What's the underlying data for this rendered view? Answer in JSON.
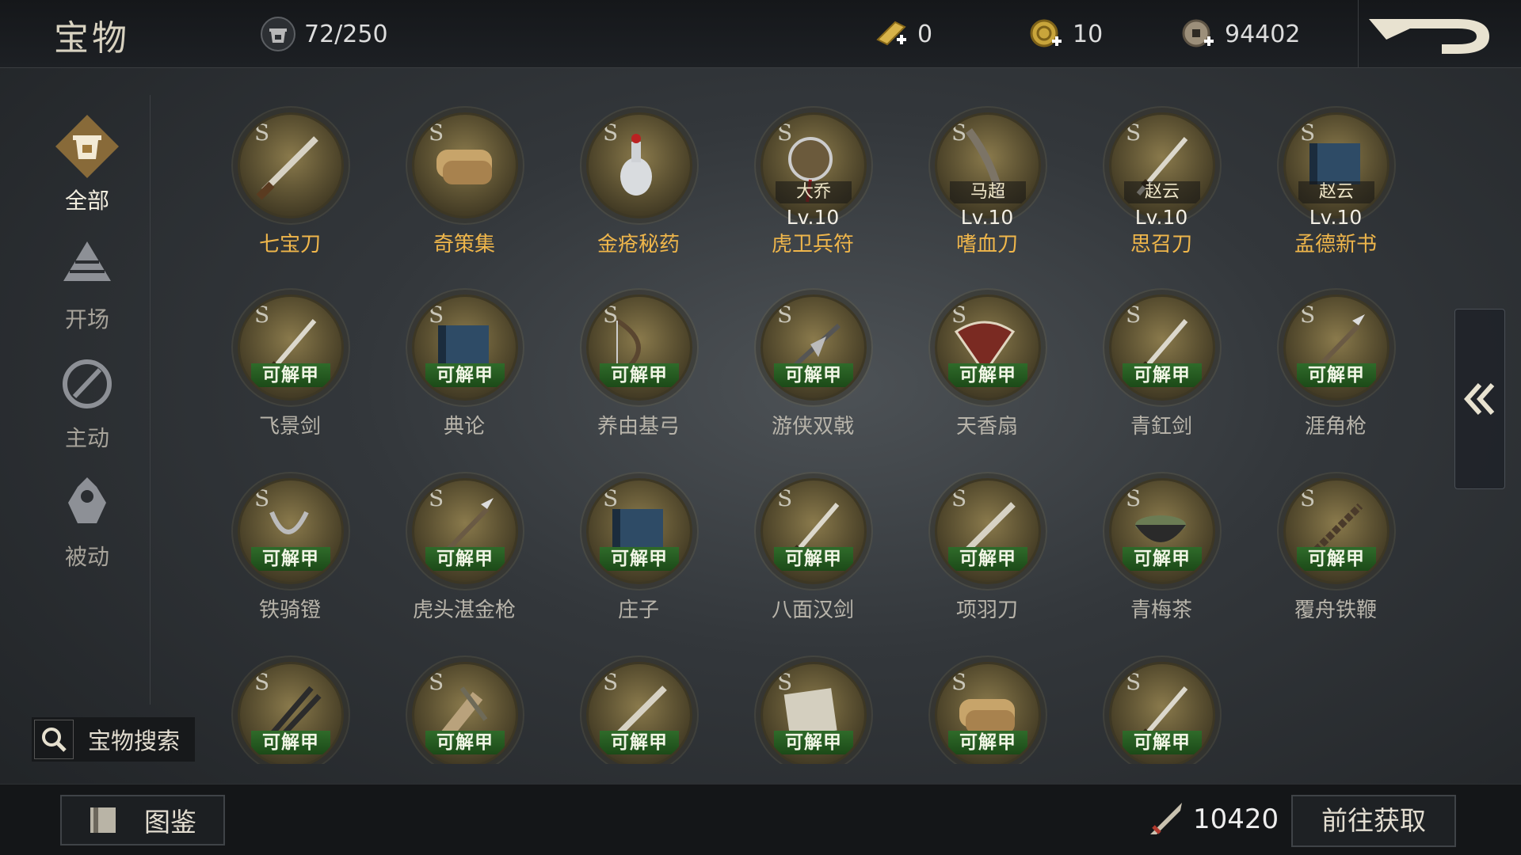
{
  "header": {
    "title": "宝物",
    "capacity": "72/250",
    "gold_ingot": "0",
    "coupon": "10",
    "silver": "94402"
  },
  "sidebar": {
    "items": [
      {
        "label": "全部",
        "icon": "all-treasure-icon",
        "active": true
      },
      {
        "label": "开场",
        "icon": "opening-icon",
        "active": false
      },
      {
        "label": "主动",
        "icon": "active-skill-icon",
        "active": false
      },
      {
        "label": "被动",
        "icon": "passive-skill-icon",
        "active": false
      }
    ],
    "search_label": "宝物搜索"
  },
  "grid": {
    "items": [
      {
        "name": "七宝刀",
        "grade": "S",
        "icon": "blade-icon",
        "name_color": "gold"
      },
      {
        "name": "奇策集",
        "grade": "S",
        "icon": "scrolls-icon",
        "name_color": "gold"
      },
      {
        "name": "金疮秘药",
        "grade": "S",
        "icon": "medicine-icon",
        "name_color": "gold"
      },
      {
        "name": "虎卫兵符",
        "grade": "S",
        "icon": "tiger-tally-icon",
        "name_color": "gold",
        "owner": "大乔",
        "level": "Lv.10"
      },
      {
        "name": "嗜血刀",
        "grade": "S",
        "icon": "blood-blade-icon",
        "name_color": "gold",
        "owner": "马超",
        "level": "Lv.10"
      },
      {
        "name": "思召刀",
        "grade": "S",
        "icon": "sword-icon",
        "name_color": "gold",
        "owner": "赵云",
        "level": "Lv.10"
      },
      {
        "name": "孟德新书",
        "grade": "S",
        "icon": "book-icon",
        "name_color": "gold",
        "owner": "赵云",
        "level": "Lv.10"
      },
      {
        "name": "飞景剑",
        "grade": "S",
        "icon": "sword-icon",
        "name_color": "grey",
        "tag": "可解甲"
      },
      {
        "name": "典论",
        "grade": "S",
        "icon": "book-icon",
        "name_color": "grey",
        "tag": "可解甲"
      },
      {
        "name": "养由基弓",
        "grade": "S",
        "icon": "bow-icon",
        "name_color": "grey",
        "tag": "可解甲"
      },
      {
        "name": "游侠双戟",
        "grade": "S",
        "icon": "halberd-icon",
        "name_color": "grey",
        "tag": "可解甲"
      },
      {
        "name": "天香扇",
        "grade": "S",
        "icon": "fan-icon",
        "name_color": "grey",
        "tag": "可解甲"
      },
      {
        "name": "青釭剑",
        "grade": "S",
        "icon": "sword-icon",
        "name_color": "grey",
        "tag": "可解甲"
      },
      {
        "name": "涯角枪",
        "grade": "S",
        "icon": "spear-icon",
        "name_color": "grey",
        "tag": "可解甲"
      },
      {
        "name": "铁骑镫",
        "grade": "S",
        "icon": "stirrup-icon",
        "name_color": "grey",
        "tag": "可解甲"
      },
      {
        "name": "虎头湛金枪",
        "grade": "S",
        "icon": "spear-icon",
        "name_color": "grey",
        "tag": "可解甲"
      },
      {
        "name": "庄子",
        "grade": "S",
        "icon": "book-icon",
        "name_color": "grey",
        "tag": "可解甲"
      },
      {
        "name": "八面汉剑",
        "grade": "S",
        "icon": "sword-icon",
        "name_color": "grey",
        "tag": "可解甲"
      },
      {
        "name": "项羽刀",
        "grade": "S",
        "icon": "blade-icon",
        "name_color": "grey",
        "tag": "可解甲"
      },
      {
        "name": "青梅茶",
        "grade": "S",
        "icon": "tea-bowl-icon",
        "name_color": "grey",
        "tag": "可解甲"
      },
      {
        "name": "覆舟铁鞭",
        "grade": "S",
        "icon": "whip-icon",
        "name_color": "grey",
        "tag": "可解甲"
      },
      {
        "name": "",
        "grade": "S",
        "icon": "twin-sword-icon",
        "name_color": "grey",
        "tag": "可解甲"
      },
      {
        "name": "",
        "grade": "S",
        "icon": "feather-scroll-icon",
        "name_color": "grey",
        "tag": "可解甲"
      },
      {
        "name": "",
        "grade": "S",
        "icon": "blade-icon",
        "name_color": "grey",
        "tag": "可解甲"
      },
      {
        "name": "",
        "grade": "S",
        "icon": "document-icon",
        "name_color": "grey",
        "tag": "可解甲"
      },
      {
        "name": "",
        "grade": "S",
        "icon": "scrolls-icon",
        "name_color": "grey",
        "tag": "可解甲"
      },
      {
        "name": "",
        "grade": "S",
        "icon": "sword-icon",
        "name_color": "grey",
        "tag": "可解甲"
      }
    ]
  },
  "footer": {
    "codex_label": "图鉴",
    "score": "10420",
    "goto_label": "前往获取"
  },
  "colors": {
    "gold_text": "#efb64b",
    "tag_green": "#2f6b2a"
  }
}
